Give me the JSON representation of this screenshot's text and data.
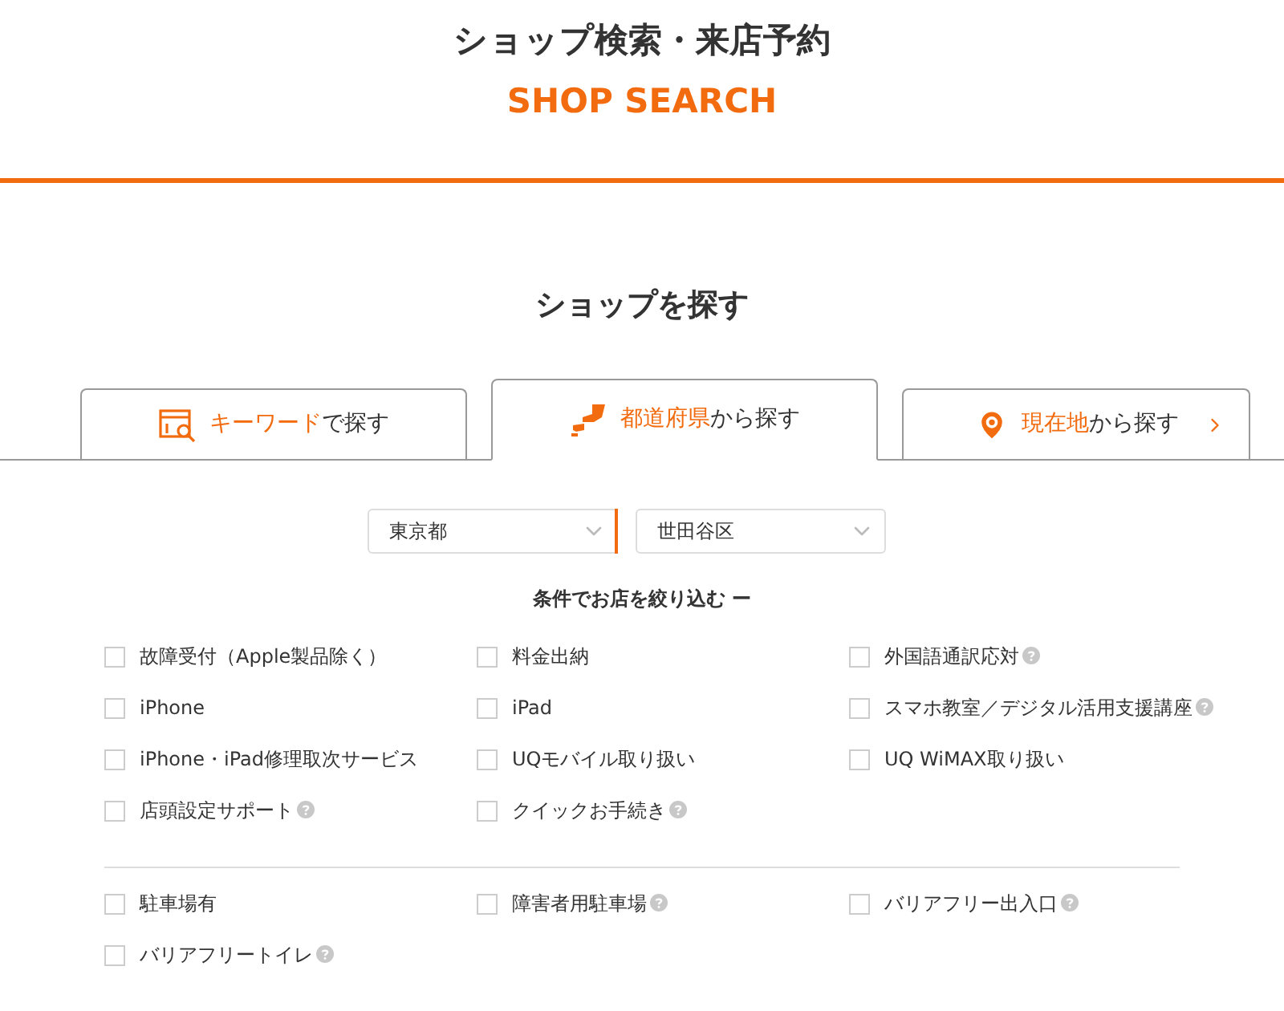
{
  "header": {
    "title": "ショップ検索・来店予約",
    "subtitle": "SHOP SEARCH"
  },
  "section_title": "ショップを探す",
  "tabs": [
    {
      "kind": "keyword",
      "highlight": "キーワード",
      "rest": "で探す",
      "selected": false,
      "chevron": false
    },
    {
      "kind": "prefecture",
      "highlight": "都道府県",
      "rest": "から探す",
      "selected": true,
      "chevron": false
    },
    {
      "kind": "location",
      "highlight": "現在地",
      "rest": "から探す",
      "selected": false,
      "chevron": true
    }
  ],
  "selects": [
    {
      "value": "東京都",
      "focused": true
    },
    {
      "value": "世田谷区",
      "focused": false
    }
  ],
  "filter": {
    "title": "条件でお店を絞り込む",
    "toggle": "ー"
  },
  "filter_groups": [
    {
      "items": [
        {
          "label": "故障受付（Apple製品除く）",
          "checked": false,
          "help": false
        },
        {
          "label": "料金出納",
          "checked": false,
          "help": false
        },
        {
          "label": "外国語通訳応対",
          "checked": false,
          "help": true
        },
        {
          "label": "iPhone",
          "checked": false,
          "help": false
        },
        {
          "label": "iPad",
          "checked": false,
          "help": false
        },
        {
          "label": "スマホ教室／デジタル活用支援講座",
          "checked": false,
          "help": true
        },
        {
          "label": "iPhone・iPad修理取次サービス",
          "checked": false,
          "help": false
        },
        {
          "label": "UQモバイル取り扱い",
          "checked": false,
          "help": false
        },
        {
          "label": "UQ WiMAX取り扱い",
          "checked": false,
          "help": false
        },
        {
          "label": "店頭設定サポート",
          "checked": false,
          "help": true
        },
        {
          "label": "クイックお手続き",
          "checked": false,
          "help": true
        }
      ]
    },
    {
      "items": [
        {
          "label": "駐車場有",
          "checked": false,
          "help": false
        },
        {
          "label": "障害者用駐車場",
          "checked": false,
          "help": true
        },
        {
          "label": "バリアフリー出入口",
          "checked": false,
          "help": true
        },
        {
          "label": "バリアフリートイレ",
          "checked": false,
          "help": true
        }
      ]
    }
  ]
}
